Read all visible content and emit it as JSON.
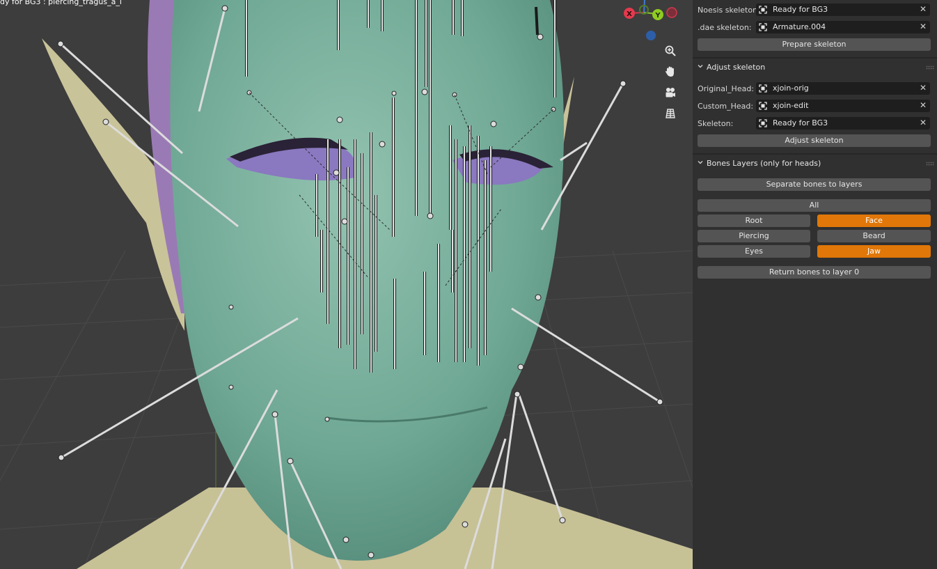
{
  "viewport": {
    "title": "dy for BG3 : piercing_tragus_a_l",
    "axes": {
      "x": "X",
      "y": "Y"
    },
    "icons": [
      "zoom-icon",
      "hand-pan-icon",
      "camera-icon",
      "grid-icon"
    ]
  },
  "panel": {
    "noesis_label": "Noesis skeleton:",
    "noesis_value": "Ready for BG3",
    "dae_label": ".dae skeleton:",
    "dae_value": "Armature.004",
    "prepare_button": "Prepare skeleton",
    "adjust_section": "Adjust skeleton",
    "original_head_label": "Original_Head:",
    "original_head_value": "xjoin-orig",
    "custom_head_label": "Custom_Head:",
    "custom_head_value": "xjoin-edit",
    "skeleton_label": "Skeleton:",
    "skeleton_value": "Ready for BG3",
    "adjust_button": "Adjust skeleton",
    "layers_section": "Bones Layers (only for heads)",
    "separate_button": "Separate bones to layers",
    "all_button": "All",
    "layers": [
      {
        "label": "Root",
        "active": false
      },
      {
        "label": "Face",
        "active": true
      },
      {
        "label": "Piercing",
        "active": false
      },
      {
        "label": "Beard",
        "active": false
      },
      {
        "label": "Eyes",
        "active": false
      },
      {
        "label": "Jaw",
        "active": true
      }
    ],
    "return_button": "Return bones to layer 0"
  },
  "colors": {
    "active_toggle": "#e07708",
    "button": "#545454",
    "panel_bg": "#303030",
    "field_bg": "#1e1e1e",
    "viewport_bg": "#3d3d3d",
    "head_green": "#6fa895",
    "ear_khaki": "#c9c39a",
    "hair_purple": "#9a7ab4"
  }
}
